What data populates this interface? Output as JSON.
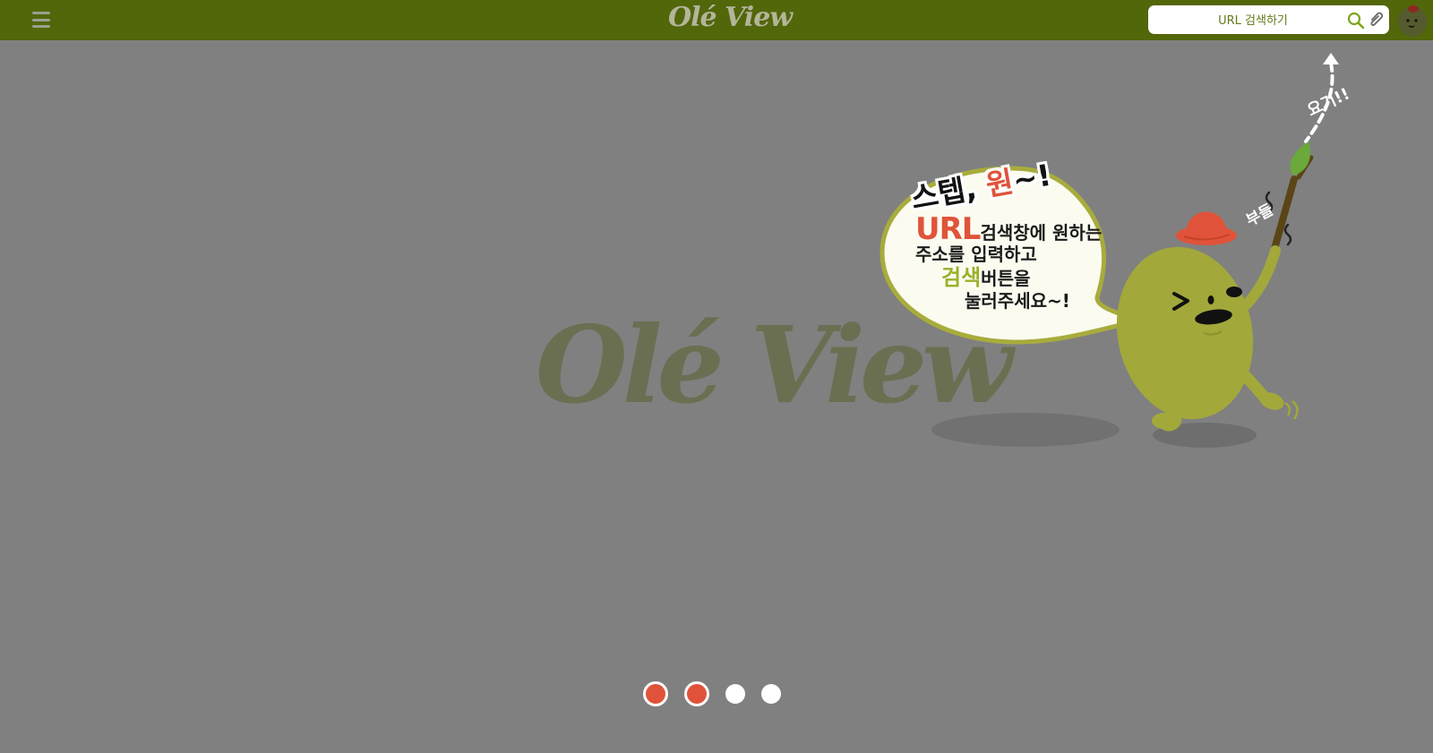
{
  "header": {
    "brand": "Olé View",
    "search": {
      "placeholder": "URL 검색하기",
      "value": ""
    },
    "icons": [
      "menu-icon",
      "search-icon",
      "paperclip-icon",
      "olive-avatar-icon"
    ]
  },
  "main": {
    "watermark": "Olé View",
    "tutorial": {
      "title_prefix": "스텝, ",
      "title_highlight": "원",
      "title_suffix": "~!",
      "line1_highlight": "URL",
      "line1_rest": "검색창에 원하는",
      "line2": "주소를 입력하고",
      "line3_highlight": "검색",
      "line3_rest": "버튼을",
      "line4": "눌러주세요~!",
      "pointer_label": "요기!!",
      "shake_label": "부들"
    }
  },
  "pagination": {
    "total": 4,
    "active": [
      1,
      2
    ]
  },
  "colors": {
    "header_bg": "#52660a",
    "overlay_bg": "#808080",
    "accent_red": "#e0533a",
    "olive": "#a2a83a",
    "highlight_green": "#9bb02a"
  }
}
